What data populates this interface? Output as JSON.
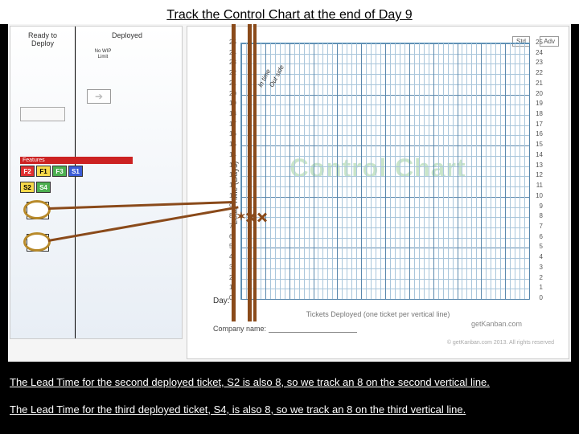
{
  "title": "Track the Control Chart at the end of Day 9",
  "kanban": {
    "col1": "Ready to\nDeploy",
    "col2": "Deployed",
    "wip": "No WIP\nLimit",
    "row_header": "Features",
    "tickets_row1": [
      "F2",
      "F1",
      "F3",
      "S1"
    ],
    "tickets_row2": [
      "S2",
      "S4"
    ]
  },
  "chart": {
    "watermark": "Control Chart",
    "ylabel": "Lead Time (Days)",
    "xlabel": "Tickets Deployed (one ticket per vertical line)",
    "day": "Day:",
    "company": "Company name:",
    "legend1": "Std",
    "legend2": "Adv",
    "brand": "getKanban.com",
    "copyright": "© getKanban.com 2013. All rights reserved",
    "annot1": "In time",
    "annot2": "Out side"
  },
  "caption1": "The Lead Time for the second deployed ticket, S2 is also 8, so we track an 8 on the second vertical line.",
  "caption2": "The Lead Time for the third deployed ticket, S4, is also 8, so we track an 8 on the third vertical line.",
  "chart_data": {
    "type": "scatter",
    "title": "Control Chart",
    "xlabel": "Tickets Deployed (one ticket per vertical line)",
    "ylabel": "Lead Time (Days)",
    "ylim": [
      0,
      25
    ],
    "points": [
      {
        "ticket": "S1",
        "x": 1,
        "y": 8
      },
      {
        "ticket": "S2",
        "x": 2,
        "y": 8
      },
      {
        "ticket": "S4",
        "x": 3,
        "y": 8
      }
    ]
  }
}
